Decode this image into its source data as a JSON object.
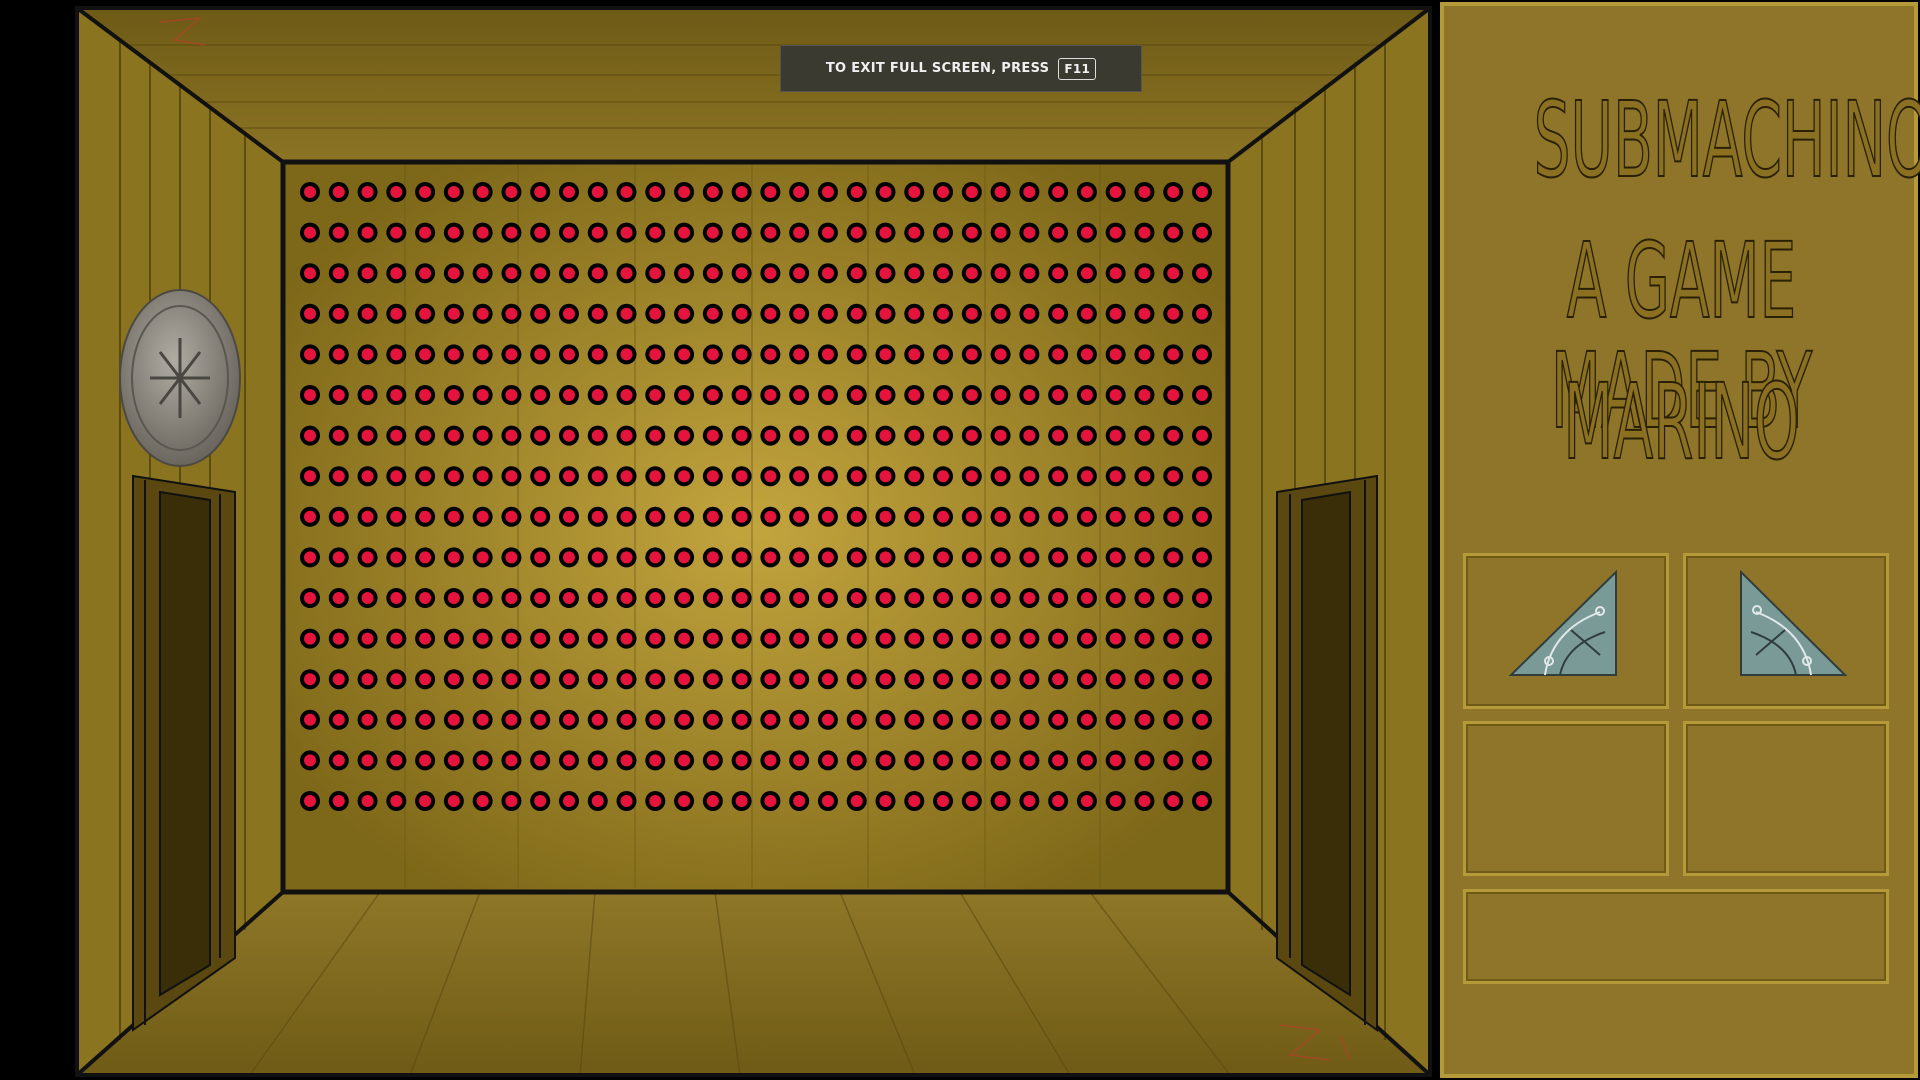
{
  "fullscreen_notice": {
    "text": "TO EXIT FULL SCREEN, PRESS",
    "key": "F11"
  },
  "sidebar": {
    "title_lines": [
      "SUBMACHINO",
      "A GAME MADE BY",
      "MARINO"
    ]
  },
  "inventory": {
    "slots": [
      {
        "item": "triangle-piece-right"
      },
      {
        "item": "triangle-piece-left"
      },
      {
        "item": ""
      },
      {
        "item": ""
      },
      {
        "item": ""
      }
    ]
  },
  "room": {
    "wall_grid": {
      "rows": 16,
      "cols": 32,
      "dot_color": "#e5143c"
    },
    "wall_item": "silver-coin",
    "doors": [
      "left-door",
      "right-door"
    ]
  },
  "colors": {
    "wall": "#8a7420",
    "panel": "#8e7529",
    "back_wall_center": "#c1a23c",
    "dot": "#e5143c"
  }
}
